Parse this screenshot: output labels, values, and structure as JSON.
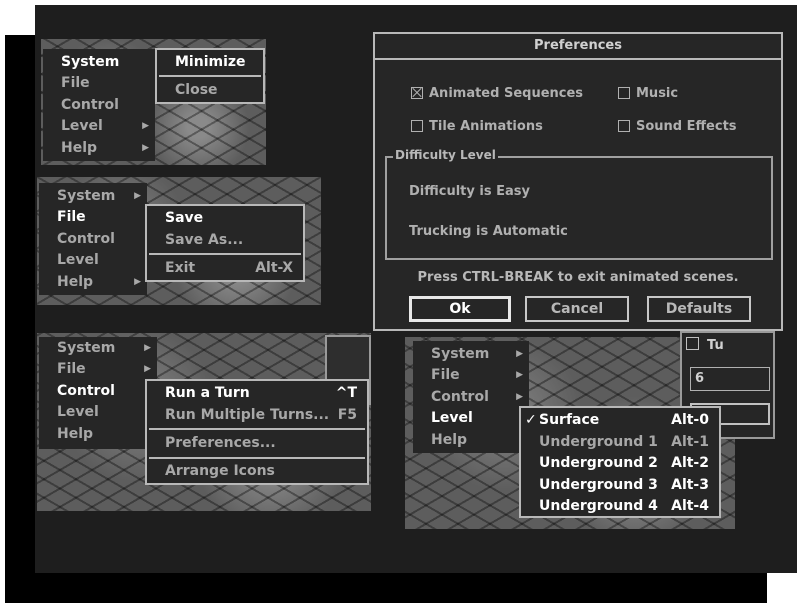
{
  "menu1": {
    "main": [
      "System",
      "File",
      "Control",
      "Level",
      "Help"
    ],
    "sub": [
      "Minimize",
      "Close"
    ]
  },
  "menu2": {
    "main": [
      "System",
      "File",
      "Control",
      "Level",
      "Help"
    ],
    "sub": [
      {
        "label": "Save",
        "shortcut": ""
      },
      {
        "label": "Save As...",
        "shortcut": ""
      },
      {
        "label": "Exit",
        "shortcut": "Alt-X"
      }
    ]
  },
  "menu3": {
    "main": [
      "System",
      "File",
      "Control",
      "Level",
      "Help"
    ],
    "sub": [
      {
        "label": "Run a Turn",
        "shortcut": "^T"
      },
      {
        "label": "Run Multiple Turns...",
        "shortcut": "F5"
      },
      {
        "label": "Preferences...",
        "shortcut": ""
      },
      {
        "label": "Arrange Icons",
        "shortcut": ""
      }
    ]
  },
  "menu4": {
    "main": [
      "System",
      "File",
      "Control",
      "Level",
      "Help"
    ],
    "check": "✓",
    "sub": [
      {
        "label": "Surface",
        "shortcut": "Alt-0"
      },
      {
        "label": "Underground 1",
        "shortcut": "Alt-1"
      },
      {
        "label": "Underground 2",
        "shortcut": "Alt-2"
      },
      {
        "label": "Underground 3",
        "shortcut": "Alt-3"
      },
      {
        "label": "Underground 4",
        "shortcut": "Alt-4"
      }
    ],
    "partial": {
      "title": "Tu",
      "value": "6"
    }
  },
  "preferences": {
    "title": "Preferences",
    "options": [
      {
        "label": "Animated Sequences",
        "checked": true
      },
      {
        "label": "Music",
        "checked": false
      },
      {
        "label": "Tile Animations",
        "checked": false
      },
      {
        "label": "Sound Effects",
        "checked": false
      }
    ],
    "group_title": "Difficulty Level",
    "difficulty_text": "Difficulty is Easy",
    "trucking_text": "Trucking is Automatic",
    "hint": "Press CTRL-BREAK to exit animated scenes.",
    "buttons": {
      "ok": "Ok",
      "cancel": "Cancel",
      "defaults": "Defaults"
    }
  },
  "colors": {
    "screen": "#1e1e1e",
    "menu_bg": "#262626",
    "text_dim": "#a8a8a8",
    "text_hi": "#ffffff",
    "border": "#b8b8b8"
  },
  "icons": {
    "submenu": "triangle-right",
    "check": "checkmark",
    "checkbox": "x-box"
  }
}
